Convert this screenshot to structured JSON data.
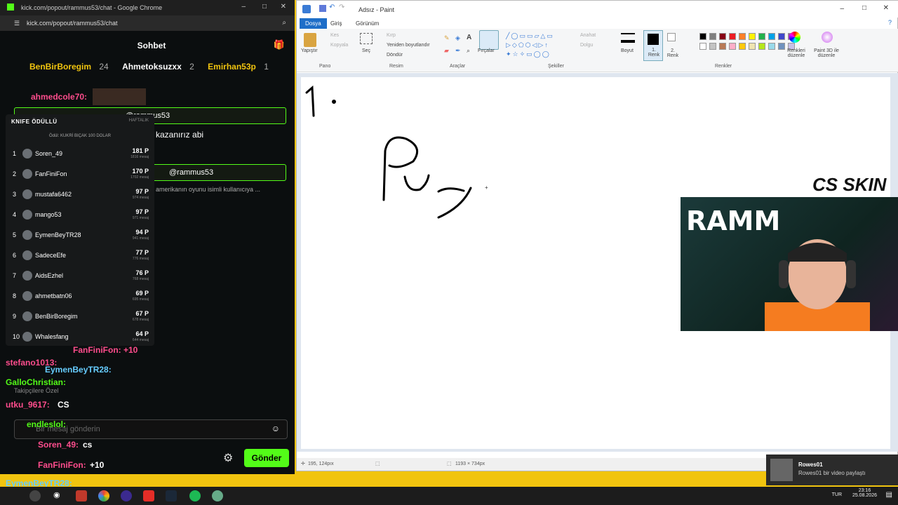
{
  "chrome": {
    "title": "kick.com/popout/rammus53/chat - Google Chrome",
    "url": "kick.com/popout/rammus53/chat"
  },
  "chat": {
    "header": "Sohbet",
    "top_gifters": [
      {
        "name": "BenBirBoregim",
        "count": "24"
      },
      {
        "name": "Ahmetoksuzxx",
        "count": "2"
      },
      {
        "name": "Emirhan53p",
        "count": "1"
      }
    ],
    "messages": [
      {
        "user": "ahmedcole70:",
        "text": ""
      },
      {
        "user": "",
        "text": "kazanırız abi"
      },
      {
        "user": "",
        "text": "amerikanın oyunu isimli kullanıcıya ..."
      },
      {
        "user": "stefano1013:",
        "text": ""
      },
      {
        "user": "EymenBeyTR28:",
        "text": ""
      },
      {
        "user": "GalloChristian:",
        "text": ""
      },
      {
        "user": "utku_9617:",
        "text": "CS"
      },
      {
        "user": "endleslol:",
        "text": ""
      },
      {
        "user": "Soren_49:",
        "text": "cs"
      },
      {
        "user": "FanFiniFon:",
        "text": "+10"
      }
    ],
    "pinned_1": "@rammus53",
    "pinned_2": "@rammus53",
    "followers_only": "Takipçilere Özel",
    "ffon_gift": "FanFiniFon: +10",
    "input_placeholder": "Bir mesaj gönderin",
    "send_label": "Gönder",
    "bottom_user": "EymenBeyTR28:"
  },
  "leaderboard": {
    "title": "KNIFE ÖDÜLLÜ",
    "period": "HAFTALIK",
    "prize": "Ödül: KUKRİ BIÇAK 100 DOLAR",
    "rows": [
      {
        "rank": "1",
        "name": "Soren_49",
        "points": "181 P",
        "msgs": "1816 mesaj"
      },
      {
        "rank": "2",
        "name": "FanFiniFon",
        "points": "170 P",
        "msgs": "1702 mesaj"
      },
      {
        "rank": "3",
        "name": "mustafa6462",
        "points": "97 P",
        "msgs": "974 mesaj"
      },
      {
        "rank": "4",
        "name": "mango53",
        "points": "97 P",
        "msgs": "971 mesaj"
      },
      {
        "rank": "5",
        "name": "EymenBeyTR28",
        "points": "94 P",
        "msgs": "941 mesaj"
      },
      {
        "rank": "6",
        "name": "SadeceEfe",
        "points": "77 P",
        "msgs": "776 mesaj"
      },
      {
        "rank": "7",
        "name": "AidsEzhel",
        "points": "76 P",
        "msgs": "768 mesaj"
      },
      {
        "rank": "8",
        "name": "ahmetbatn06",
        "points": "69 P",
        "msgs": "695 mesaj"
      },
      {
        "rank": "9",
        "name": "BenBirBoregim",
        "points": "67 P",
        "msgs": "678 mesaj"
      },
      {
        "rank": "10",
        "name": "Whalesfang",
        "points": "64 P",
        "msgs": "644 mesaj"
      }
    ]
  },
  "paint": {
    "title": "Adsız - Paint",
    "tabs": [
      "Dosya",
      "Giriş",
      "Görünüm"
    ],
    "groups": {
      "pano": "Pano",
      "resim": "Resim",
      "araclar": "Araçlar",
      "sekiller": "Şekiller",
      "renkler": "Renkler"
    },
    "buttons": {
      "paste": "Yapıştır",
      "cut": "Kes",
      "copy": "Kopyala",
      "select": "Seç",
      "crop": "Kırp",
      "resize": "Yeniden boyutlandır",
      "rotate": "Döndür",
      "brushes": "Fırçalar",
      "outline": "Anahat",
      "fill": "Dolgu",
      "size": "Boyut",
      "color1": "1. Renk",
      "color2": "2. Renk",
      "edit_colors": "Renkleri düzenle",
      "paint3d": "Paint 3D ile düzenle"
    },
    "palette": [
      "#000000",
      "#7f7f7f",
      "#880015",
      "#ed1c24",
      "#ff7f27",
      "#fff200",
      "#22b14c",
      "#00a2e8",
      "#3f48cc",
      "#a349a4",
      "#ffffff",
      "#c3c3c3",
      "#b97a57",
      "#ffaec9",
      "#ffc90e",
      "#efe4b0",
      "#b5e61d",
      "#99d9ea",
      "#7092be",
      "#c8bfe7"
    ],
    "status_pos": "195, 124pıx",
    "status_size": "1193 × 734px"
  },
  "overlay": {
    "cam_text": "RAMM",
    "cs_skin": "CS SKIN"
  },
  "taskbar": {
    "lang": "TUR",
    "time": "23:16",
    "date": "25.08.2026"
  },
  "notification": {
    "user": "Rowes01",
    "text": "Rowes01 bir video paylaştı"
  }
}
